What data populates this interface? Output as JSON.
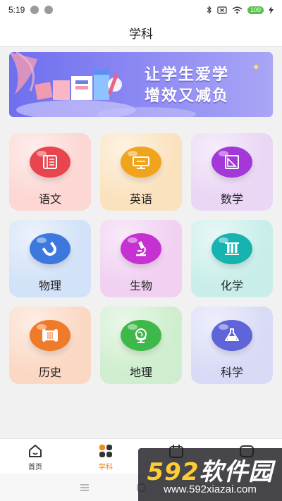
{
  "status_bar": {
    "time": "5:19",
    "battery": "100"
  },
  "header": {
    "title": "学科"
  },
  "banner": {
    "line1": "让学生爱学",
    "line2": "增效又减负"
  },
  "subjects": [
    {
      "label": "语文",
      "icon": "book-page-icon",
      "color": "#e8454f",
      "bg": "#fcd7d3"
    },
    {
      "label": "英语",
      "icon": "abc-board-icon",
      "color": "#f0a41b",
      "bg": "#fbe2bf"
    },
    {
      "label": "数学",
      "icon": "protractor-icon",
      "color": "#a337d8",
      "bg": "#ead6f5"
    },
    {
      "label": "物理",
      "icon": "magnet-icon",
      "color": "#3c78de",
      "bg": "#d2e2f8"
    },
    {
      "label": "生物",
      "icon": "microscope-icon",
      "color": "#c632d1",
      "bg": "#f1d0f1"
    },
    {
      "label": "化学",
      "icon": "test-tubes-icon",
      "color": "#17b3b0",
      "bg": "#c9eeea"
    },
    {
      "label": "历史",
      "icon": "scroll-icon",
      "color": "#ef7a2a",
      "bg": "#fbd8c4"
    },
    {
      "label": "地理",
      "icon": "globe-icon",
      "color": "#3fb84a",
      "bg": "#cfeecf"
    },
    {
      "label": "科学",
      "icon": "flask-icon",
      "color": "#5f64d9",
      "bg": "#d9dbf6"
    }
  ],
  "tabs": [
    {
      "label": "首页",
      "icon": "home-icon"
    },
    {
      "label": "学科",
      "icon": "grid-icon"
    },
    {
      "label": "",
      "icon": "calendar-icon"
    },
    {
      "label": "",
      "icon": "profile-icon"
    }
  ],
  "colors": {
    "accent": "#f08a1a"
  },
  "watermark": {
    "line1_num": "592",
    "line1_text": "软件园",
    "line2": "www.592xiazai.com"
  }
}
